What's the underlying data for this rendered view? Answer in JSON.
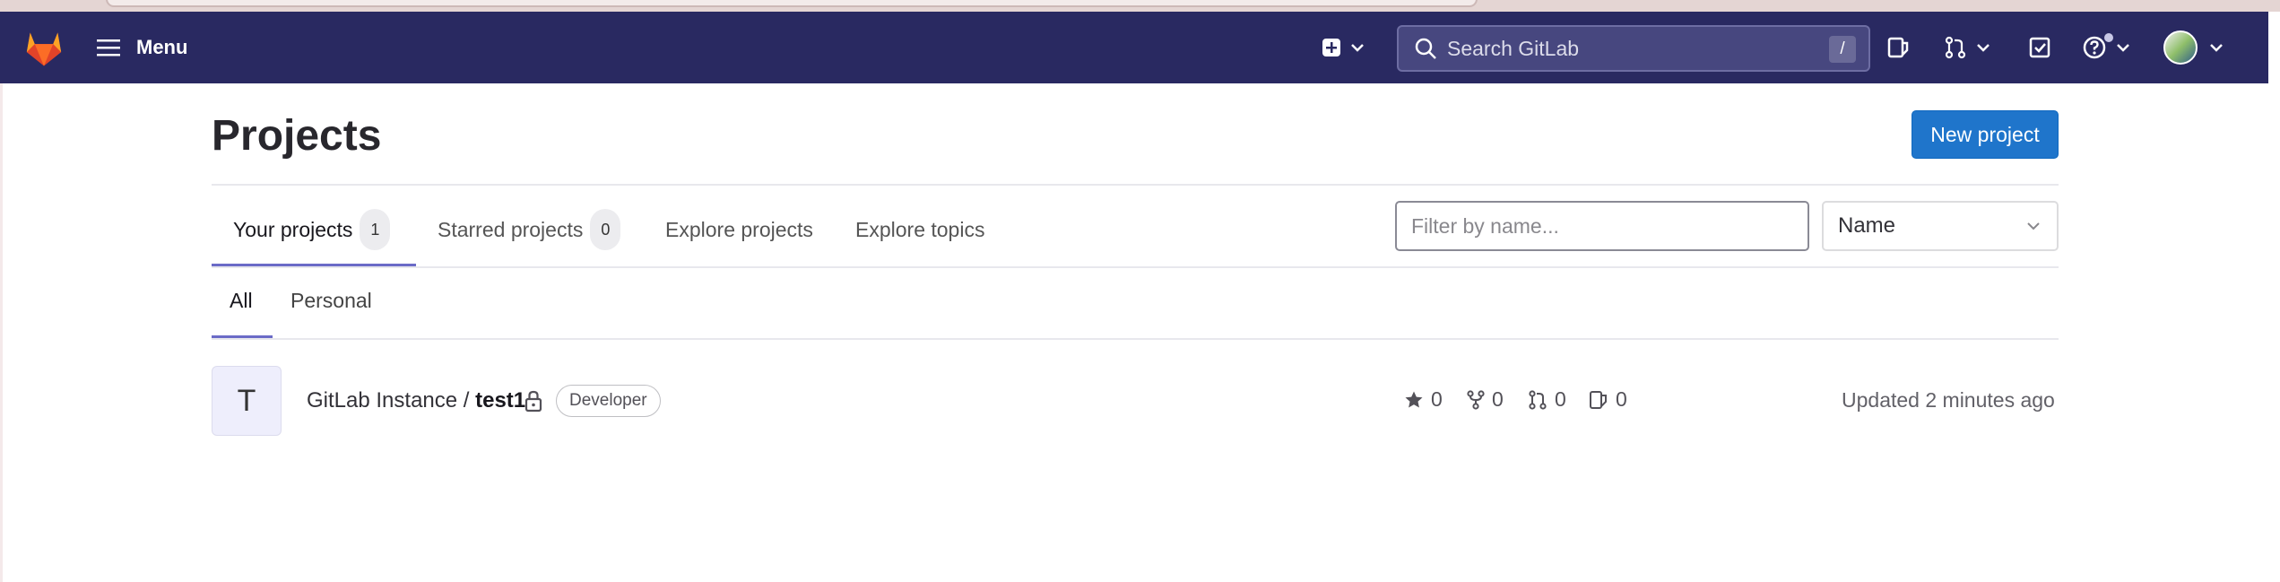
{
  "topbar": {
    "menu_label": "Menu",
    "search_placeholder": "Search GitLab",
    "search_shortcut": "/"
  },
  "page": {
    "title": "Projects",
    "new_project_label": "New project"
  },
  "tabs": [
    {
      "label": "Your projects",
      "count": "1"
    },
    {
      "label": "Starred projects",
      "count": "0"
    },
    {
      "label": "Explore projects"
    },
    {
      "label": "Explore topics"
    }
  ],
  "filter": {
    "placeholder": "Filter by name..."
  },
  "sort": {
    "selected": "Name"
  },
  "subtabs": [
    {
      "label": "All"
    },
    {
      "label": "Personal"
    }
  ],
  "project": {
    "avatar_letter": "T",
    "namespace": "GitLab Instance / ",
    "name": "test1",
    "role": "Developer",
    "stars": "0",
    "forks": "0",
    "merge_requests": "0",
    "issues": "0",
    "updated": "Updated 2 minutes ago"
  },
  "colors": {
    "topbar": "#292961",
    "primary": "#1f75cb",
    "tab_underline": "#6b6bc7"
  }
}
